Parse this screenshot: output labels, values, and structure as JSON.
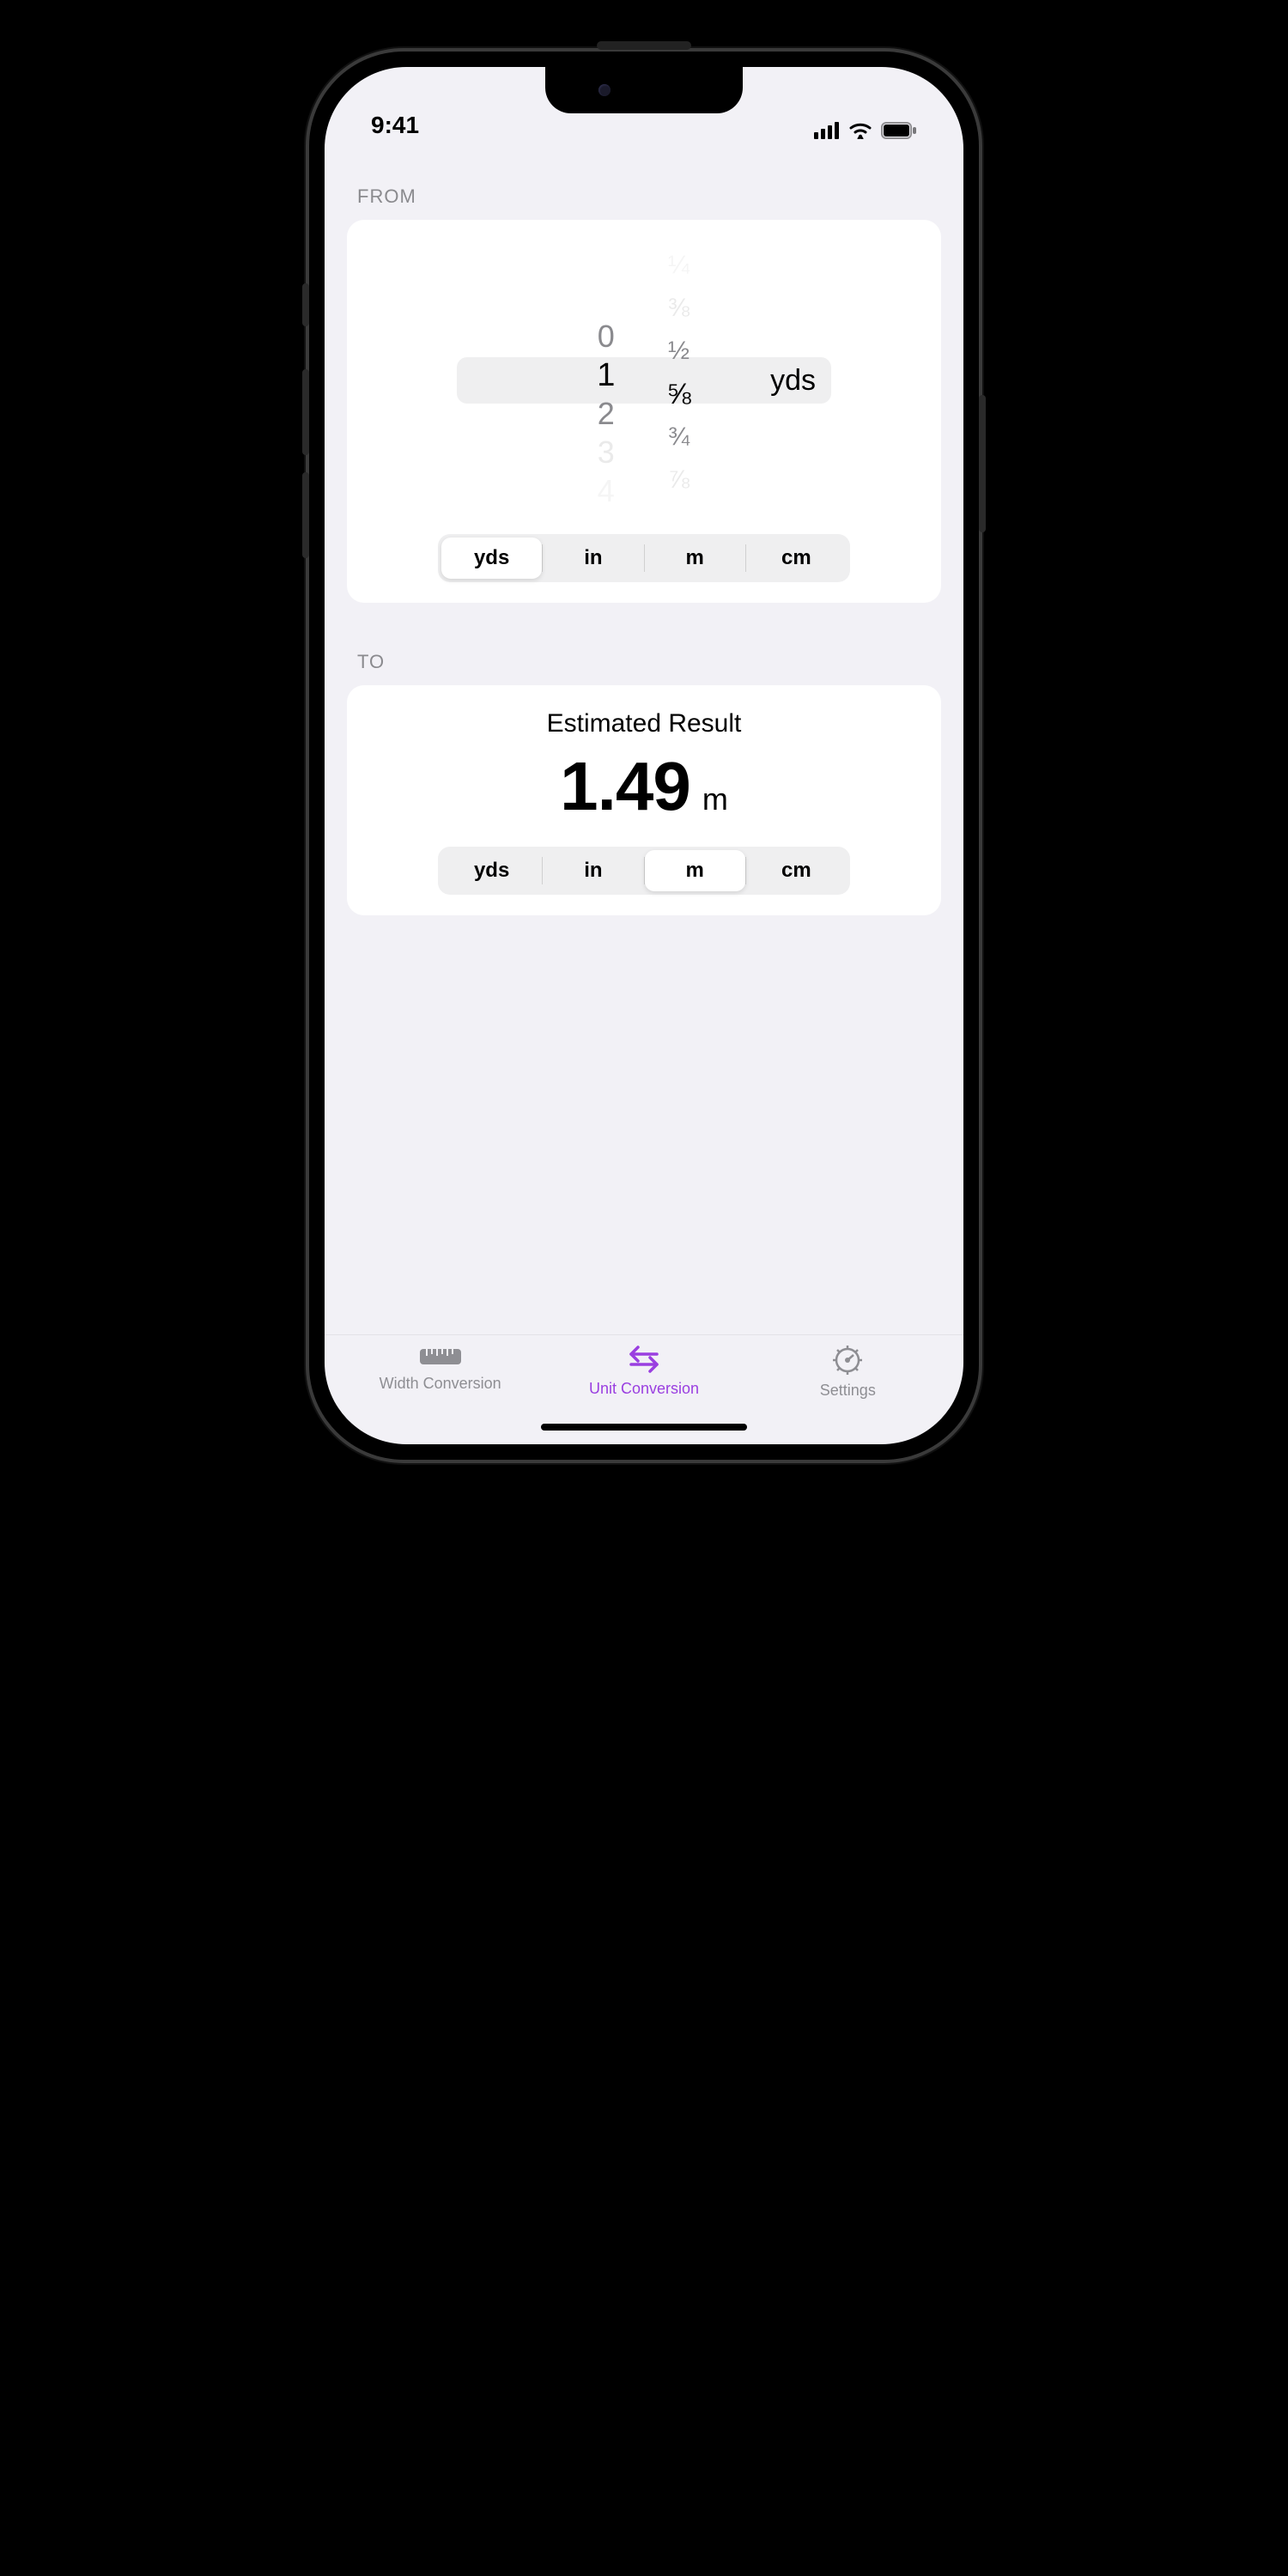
{
  "status": {
    "time": "9:41"
  },
  "from": {
    "label": "FROM",
    "whole_values": [
      "0",
      "1",
      "2",
      "3",
      "4"
    ],
    "whole_selected_index": 1,
    "fraction_values": [
      "¼",
      "⅜",
      "½",
      "⅝",
      "¾",
      "⅞"
    ],
    "fraction_selected_index": 3,
    "unit_suffix": "yds",
    "units": [
      "yds",
      "in",
      "m",
      "cm"
    ],
    "unit_selected_index": 0
  },
  "to": {
    "label": "TO",
    "title": "Estimated Result",
    "value": "1.49",
    "unit_suffix": "m",
    "units": [
      "yds",
      "in",
      "m",
      "cm"
    ],
    "unit_selected_index": 2
  },
  "tabs": {
    "items": [
      {
        "label": "Width Conversion"
      },
      {
        "label": "Unit Conversion"
      },
      {
        "label": "Settings"
      }
    ],
    "active_index": 1
  },
  "colors": {
    "accent": "#9a3fe0",
    "inactive": "#8e8e93"
  }
}
